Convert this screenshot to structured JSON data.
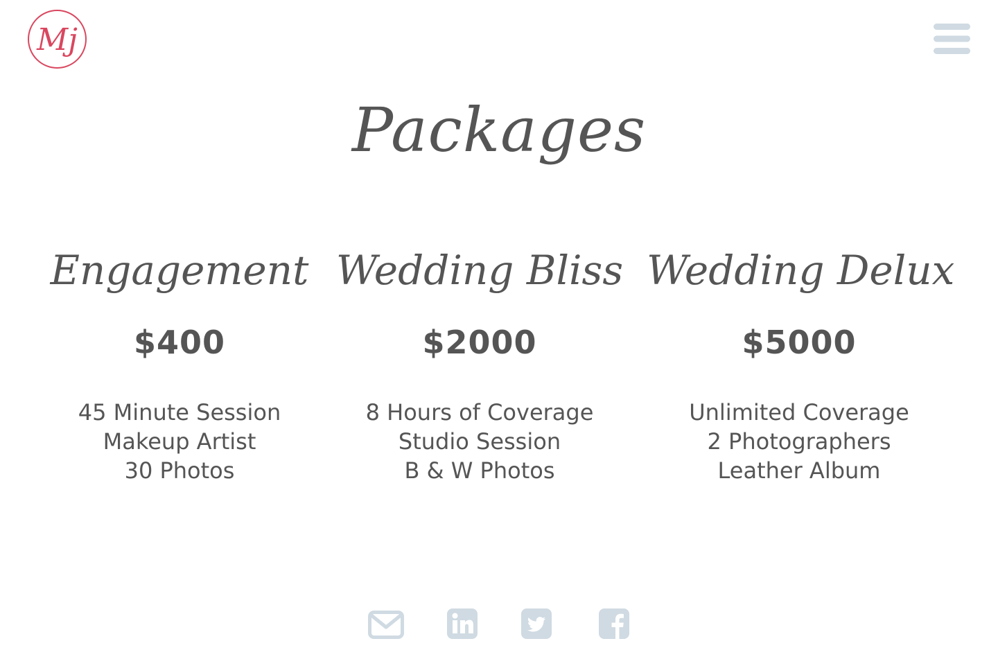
{
  "logo": {
    "monogram": "Mj",
    "icon": "mj-monogram-logo",
    "color": "#d9475f"
  },
  "menu": {
    "icon": "hamburger-menu-icon",
    "color": "#cfdae2"
  },
  "page": {
    "title": "Packages",
    "text_color": "#555555"
  },
  "packages": [
    {
      "name": "Engagement",
      "price": "$400",
      "features": [
        "45 Minute Session",
        "Makeup Artist",
        "30 Photos"
      ]
    },
    {
      "name": "Wedding Bliss",
      "price": "$2000",
      "features": [
        "8 Hours of Coverage",
        "Studio Session",
        "B & W Photos"
      ]
    },
    {
      "name": "Wedding Delux",
      "price": "$5000",
      "features": [
        "Unlimited Coverage",
        "2 Photographers",
        "Leather Album"
      ]
    }
  ],
  "social": {
    "icon_color": "#cfdae2",
    "icons": [
      "envelope-icon",
      "linkedin-icon",
      "twitter-icon",
      "facebook-icon"
    ]
  }
}
